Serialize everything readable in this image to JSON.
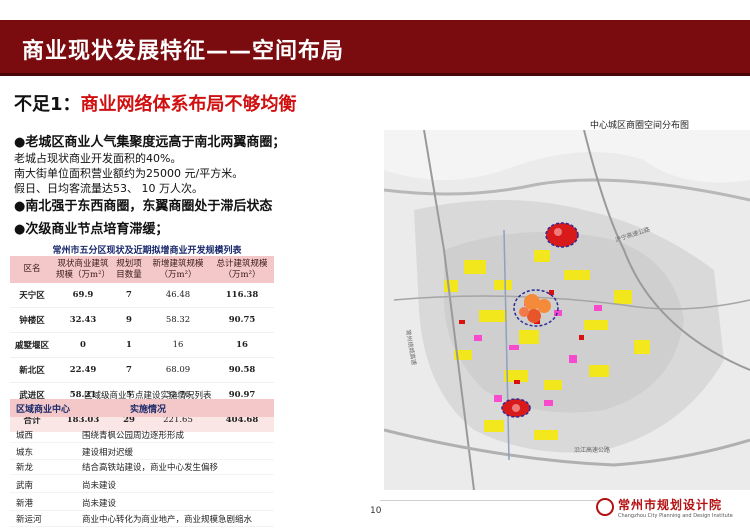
{
  "header": {
    "title": "商业现状发展特征——空间布局"
  },
  "subtitle": {
    "prefix": "不足1：",
    "main": "商业网络体系布局不够均衡"
  },
  "bullets": [
    {
      "text": "●老城区商业人气集聚度远高于南北两翼商圈；",
      "lines": [
        "老城占现状商业开发面积的40%。",
        "南大街单位面积营业额约为25000 元/平方米。",
        "假日、日均客流量达53、 10 万人次。"
      ]
    },
    {
      "text": "●南北强于东西商圈，东翼商圈处于滞后状态"
    },
    {
      "text": "●次级商业节点培育滞缓；"
    }
  ],
  "table1": {
    "caption": "常州市五分区现状及近期拟增商业开发规模列表",
    "headers": [
      "区名",
      "现状商业建筑规模（万m²）",
      "规划项目数量",
      "新增建筑规模（万m²）",
      "总计建筑规模（万m²）"
    ],
    "rows": [
      [
        "天宁区",
        "69.9",
        "7",
        "46.48",
        "116.38"
      ],
      [
        "钟楼区",
        "32.43",
        "9",
        "58.32",
        "90.75"
      ],
      [
        "戚墅堰区",
        "0",
        "1",
        "16",
        "16"
      ],
      [
        "新北区",
        "22.49",
        "7",
        "68.09",
        "90.58"
      ],
      [
        "武进区",
        "58.21",
        "5",
        "32.76",
        "90.97"
      ]
    ],
    "sum": [
      "合计",
      "183.03",
      "29",
      "221.65",
      "404.68"
    ]
  },
  "overlap_caption": "区域级商业节点建设实施情况列表",
  "table2": {
    "headers": [
      "区域商业中心",
      "实施情况"
    ],
    "rows": [
      [
        "城西",
        "围绕青枫公园周边逐形形成"
      ],
      [
        "城东",
        "建设相对迟缓"
      ],
      [
        "新龙",
        "结合高铁站建设，商业中心发生偏移"
      ],
      [
        "武南",
        "尚未建设"
      ],
      [
        "新港",
        "尚未建设"
      ],
      [
        "新运河",
        "商业中心转化为商业地产，商业规模急剧缩水"
      ]
    ]
  },
  "map": {
    "title": "中心城区商圈空间分布图",
    "labels": [
      "沪宁高速公路",
      "常州绕城高速",
      "沿江高速公路"
    ]
  },
  "footer": {
    "page": "10",
    "logo_cn": "常州市规划设计院",
    "logo_en": "Changzhou City Planning and Design Institute"
  },
  "colors": {
    "title_band": "#7a0c10",
    "accent_red": "#d01010",
    "table_header": "#f4c8c8",
    "caption_blue": "#1a2a6c"
  }
}
